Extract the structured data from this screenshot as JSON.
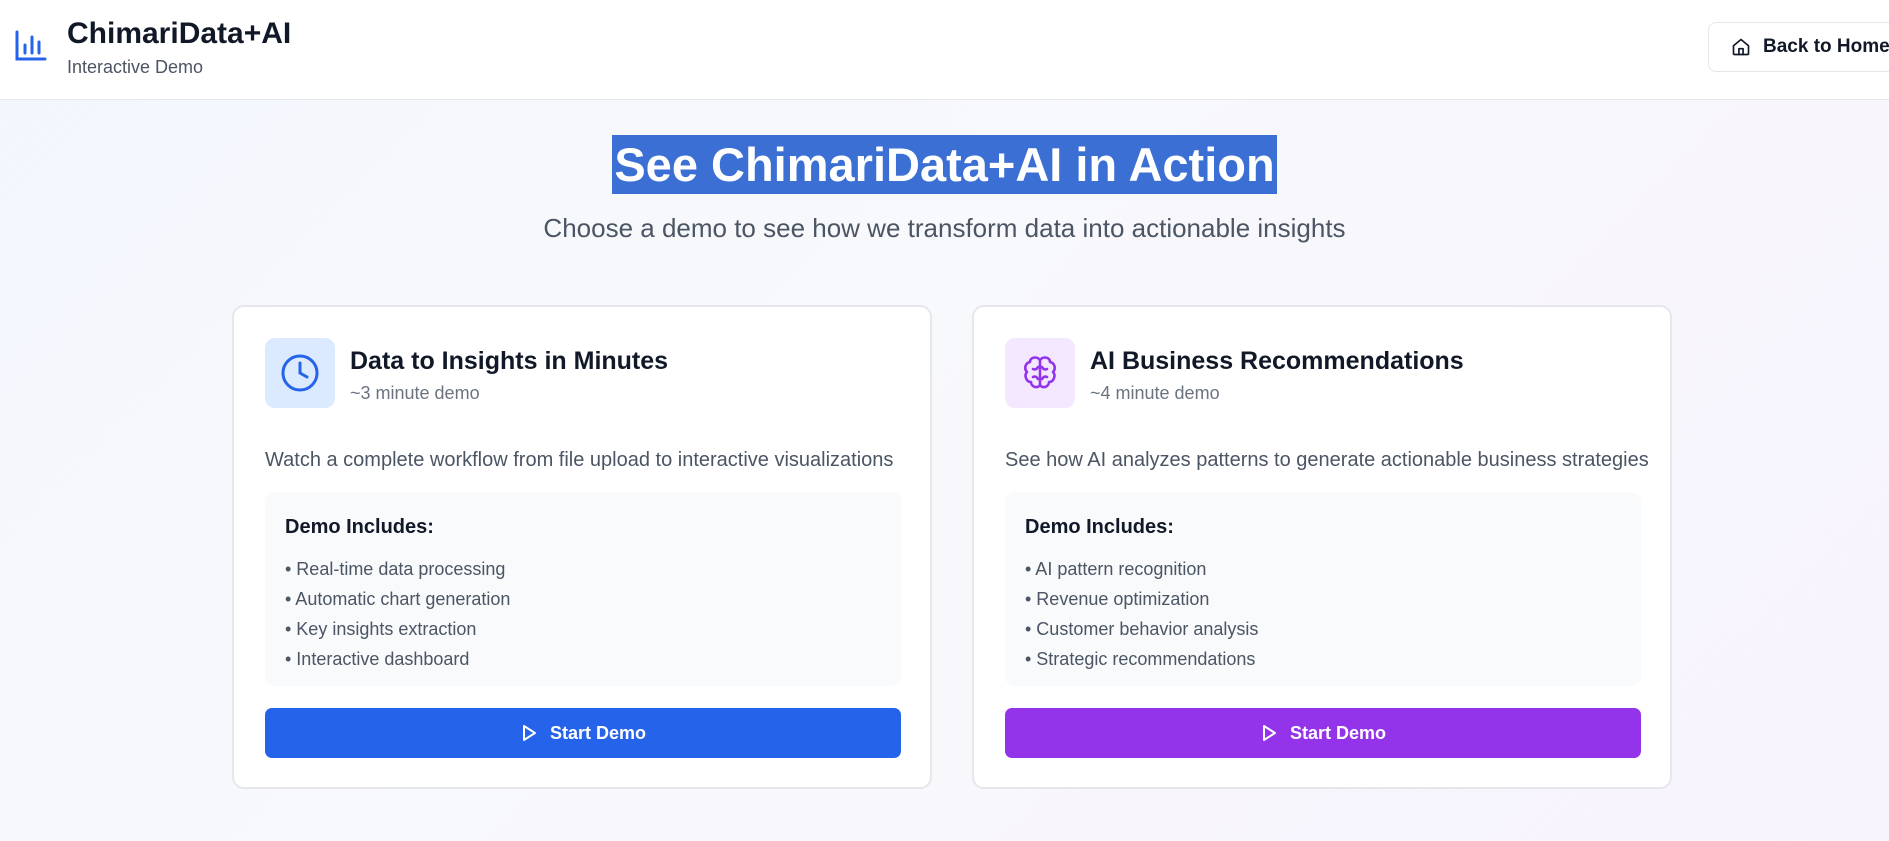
{
  "header": {
    "brand_title": "ChimariData+AI",
    "brand_subtitle": "Interactive Demo",
    "brand_icon": "bar-chart-icon",
    "back_button_label": "Back to Home",
    "back_button_icon": "home-icon"
  },
  "hero": {
    "title": "See ChimariData+AI in Action",
    "subtitle": "Choose a demo to see how we transform data into actionable insights"
  },
  "cards": [
    {
      "icon": "clock-icon",
      "accent": "#2563eb",
      "title": "Data to Insights in Minutes",
      "duration": "~3 minute demo",
      "description": "Watch a complete workflow from file upload to interactive visualizations",
      "includes_heading": "Demo Includes:",
      "includes": [
        "• Real-time data processing",
        "• Automatic chart generation",
        "• Key insights extraction",
        "• Interactive dashboard"
      ],
      "button_label": "Start Demo"
    },
    {
      "icon": "brain-icon",
      "accent": "#9333ea",
      "title": "AI Business Recommendations",
      "duration": "~4 minute demo",
      "description": "See how AI analyzes patterns to generate actionable business strategies",
      "includes_heading": "Demo Includes:",
      "includes": [
        "• AI pattern recognition",
        "• Revenue optimization",
        "• Customer behavior analysis",
        "• Strategic recommendations"
      ],
      "button_label": "Start Demo"
    }
  ]
}
